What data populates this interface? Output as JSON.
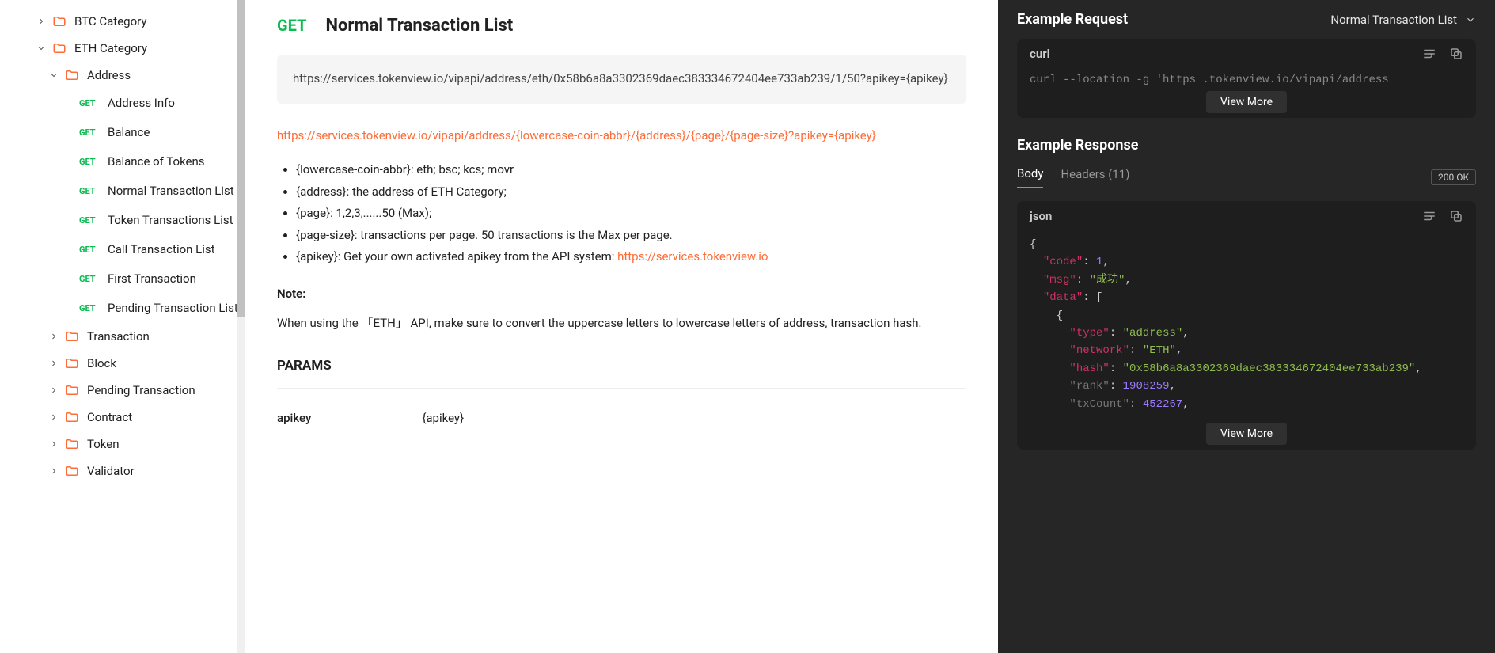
{
  "sidebar": {
    "btc": "BTC Category",
    "eth": "ETH Category",
    "address": "Address",
    "items": [
      {
        "method": "GET",
        "label": "Address Info"
      },
      {
        "method": "GET",
        "label": "Balance"
      },
      {
        "method": "GET",
        "label": "Balance of Tokens"
      },
      {
        "method": "GET",
        "label": "Normal Transaction List"
      },
      {
        "method": "GET",
        "label": "Token Transactions List"
      },
      {
        "method": "GET",
        "label": "Call Transaction List"
      },
      {
        "method": "GET",
        "label": "First Transaction"
      },
      {
        "method": "GET",
        "label": "Pending Transaction List"
      }
    ],
    "folders": [
      "Transaction",
      "Block",
      "Pending Transaction",
      "Contract",
      "Token",
      "Validator"
    ]
  },
  "main": {
    "method": "GET",
    "title": "Normal Transaction List",
    "url": "https://services.tokenview.io/vipapi/address/eth/0x58b6a8a3302369daec383334672404ee733ab239/1/50?apikey={apikey}",
    "pattern": "https://services.tokenview.io/vipapi/address/{lowercase-coin-abbr}/{address}/{page}/{page-size}?apikey={apikey}",
    "bullets": [
      "{lowercase-coin-abbr}: eth; bsc; kcs; movr",
      "{address}: the address of ETH Category;",
      "{page}: 1,2,3,......50 (Max);",
      "{page-size}: transactions per page. 50 transactions is the Max per page.",
      "{apikey}: Get your own activated apikey from the API system: "
    ],
    "apikey_link": "https://services.tokenview.io",
    "note_label": "Note:",
    "note_text": "When using the 「ETH」 API, make sure to convert the uppercase letters to lowercase letters of address, transaction hash.",
    "params_heading": "PARAMS",
    "param_key": "apikey",
    "param_val": "{apikey}"
  },
  "right": {
    "req_title": "Example Request",
    "selector": "Normal Transaction List",
    "curl_label": "curl",
    "curl_line": "curl --location -g 'https             .tokenview.io/vipapi/address",
    "view_more": "View More",
    "resp_title": "Example Response",
    "tab_body": "Body",
    "tab_headers": "Headers (11)",
    "status": "200 OK",
    "json_label": "json",
    "json": {
      "code": 1,
      "msg": "成功",
      "type": "address",
      "network": "ETH",
      "hash": "0x58b6a8a3302369daec383334672404ee733ab239",
      "rank": 1908259,
      "txCount": 452267
    }
  }
}
